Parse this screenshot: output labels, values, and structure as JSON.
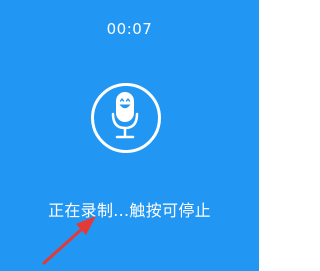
{
  "recorder": {
    "elapsed_time": "00:07",
    "status_text": "正在录制...触按可停止",
    "mic_icon": "smiling-microphone-icon"
  },
  "colors": {
    "background": "#2196f3",
    "foreground": "#ffffff",
    "annotation_arrow": "#e53935"
  }
}
